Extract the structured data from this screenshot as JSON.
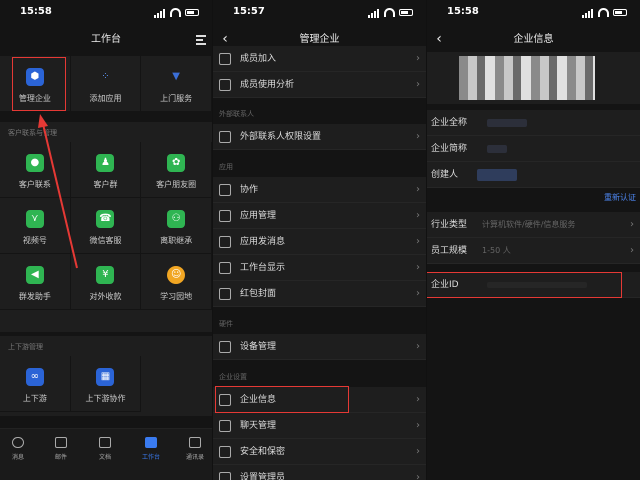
{
  "status": {
    "time1": "15:58",
    "time2": "15:57",
    "time3": "15:58"
  },
  "p1": {
    "title": "工作台",
    "top_items": [
      {
        "label": "管理企业",
        "icon": "hexagon-icon"
      },
      {
        "label": "添加应用",
        "icon": "dots-icon"
      },
      {
        "label": "上门服务",
        "icon": "tie-icon"
      }
    ],
    "sec1_title": "客户联系与管理",
    "sec1_items": [
      {
        "label": "客户联系"
      },
      {
        "label": "客户群"
      },
      {
        "label": "客户朋友圈"
      },
      {
        "label": "视频号"
      },
      {
        "label": "微信客服"
      },
      {
        "label": "离职继承"
      },
      {
        "label": "群发助手"
      },
      {
        "label": "对外收款"
      },
      {
        "label": "学习园地"
      }
    ],
    "sec2_title": "上下游管理",
    "sec2_items": [
      {
        "label": "上下游"
      },
      {
        "label": "上下游协作"
      }
    ],
    "tabs": [
      {
        "label": "消息"
      },
      {
        "label": "邮件"
      },
      {
        "label": "文档"
      },
      {
        "label": "工作台"
      },
      {
        "label": "通讯录"
      }
    ]
  },
  "p2": {
    "title": "管理企业",
    "rows_a": [
      "成员加入",
      "成员使用分析"
    ],
    "group_ext": "外部联系人",
    "row_ext": "外部联系人权限设置",
    "group_app": "应用",
    "rows_app": [
      "协作",
      "应用管理",
      "应用发消息",
      "工作台显示",
      "红包封面"
    ],
    "group_hw": "硬件",
    "row_hw": "设备管理",
    "group_ent": "企业设置",
    "rows_ent": [
      "企业信息",
      "聊天管理",
      "安全和保密",
      "设置管理员"
    ]
  },
  "p3": {
    "title": "企业信息",
    "rows": [
      {
        "label": "企业全称",
        "value": ""
      },
      {
        "label": "企业简称",
        "value": ""
      },
      {
        "label": "创建人",
        "value": ""
      }
    ],
    "verify": "重新认证",
    "rows2": [
      {
        "label": "行业类型",
        "value": "计算机软件/硬件/信息服务"
      },
      {
        "label": "员工规模",
        "value": "1-50 人"
      },
      {
        "label": "企业ID",
        "value": ""
      }
    ]
  }
}
